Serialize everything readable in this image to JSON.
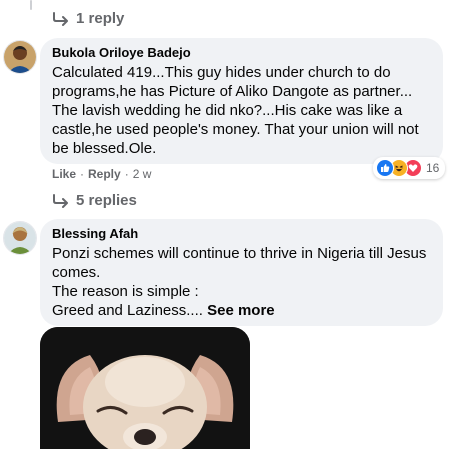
{
  "top_replies": {
    "label": "1 reply"
  },
  "comments": [
    {
      "author": "Bukola Oriloye Badejo",
      "text": "Calculated 419...This guy hides under church to do programs,he has Picture of Aliko Dangote as partner... The lavish wedding he did nko?...His cake was like a castle,he used people's money. That your union will not be blessed.Ole.",
      "like": "Like",
      "reply": "Reply",
      "time": "2 w",
      "reaction_count": "16",
      "reactions": [
        "like-reaction-icon",
        "haha-reaction-icon",
        "love-reaction-icon"
      ],
      "replies_label": "5 replies"
    },
    {
      "author": "Blessing Afah",
      "text": "Ponzi schemes will continue to thrive in Nigeria till Jesus comes.\nThe reason is simple :\nGreed and Laziness....",
      "see_more": "See more"
    }
  ],
  "colors": {
    "bubble": "#f0f2f5",
    "meta": "#65676b",
    "like_blue": "#1877f2",
    "love_red": "#f33e58",
    "haha_yellow": "#f7b125"
  },
  "icons": [
    "reply-arrow-icon",
    "dog-photo"
  ]
}
